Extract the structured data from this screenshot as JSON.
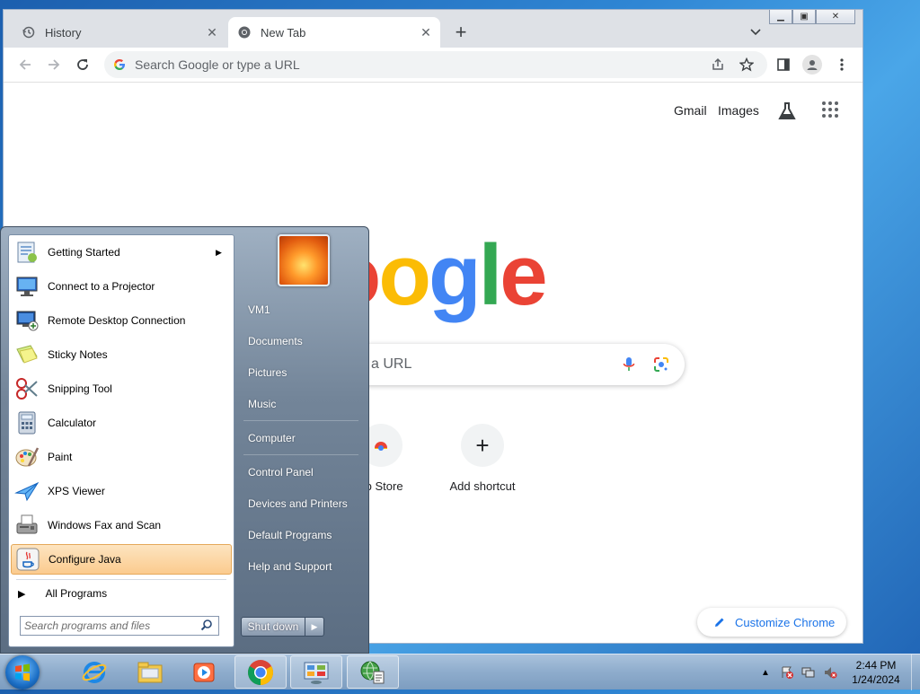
{
  "browser": {
    "tabs": [
      {
        "label": "History",
        "icon": "history-icon"
      },
      {
        "label": "New Tab",
        "icon": "chrome-icon"
      }
    ],
    "omnibox_placeholder": "Search Google or type a URL",
    "window_buttons": [
      "minimize",
      "restore",
      "close"
    ]
  },
  "ntp": {
    "links": {
      "gmail": "Gmail",
      "images": "Images"
    },
    "logo_text": "oogle",
    "search_placeholder": "a URL",
    "shortcuts": [
      {
        "label": "eb Store"
      },
      {
        "label": "Add shortcut"
      }
    ],
    "customize_label": "Customize Chrome"
  },
  "startmenu": {
    "programs": [
      {
        "label": "Getting Started",
        "icon": "getting-started-icon",
        "submenu": true
      },
      {
        "label": "Connect to a Projector",
        "icon": "projector-icon"
      },
      {
        "label": "Remote Desktop Connection",
        "icon": "remote-desktop-icon"
      },
      {
        "label": "Sticky Notes",
        "icon": "sticky-notes-icon"
      },
      {
        "label": "Snipping Tool",
        "icon": "snipping-tool-icon"
      },
      {
        "label": "Calculator",
        "icon": "calculator-icon"
      },
      {
        "label": "Paint",
        "icon": "paint-icon"
      },
      {
        "label": "XPS Viewer",
        "icon": "xps-viewer-icon"
      },
      {
        "label": "Windows Fax and Scan",
        "icon": "fax-scan-icon"
      },
      {
        "label": "Configure Java",
        "icon": "java-icon",
        "highlighted": true
      }
    ],
    "all_programs": "All Programs",
    "search_placeholder": "Search programs and files",
    "right_links": [
      "VM1",
      "Documents",
      "Pictures",
      "Music",
      "Computer",
      "Control Panel",
      "Devices and Printers",
      "Default Programs",
      "Help and Support"
    ],
    "shutdown_label": "Shut down"
  },
  "taskbar": {
    "time": "2:44 PM",
    "date": "1/24/2024",
    "pinned": [
      "internet-explorer-icon",
      "file-explorer-icon",
      "media-player-icon",
      "chrome-icon",
      "control-panel-icon",
      "network-app-icon"
    ]
  }
}
